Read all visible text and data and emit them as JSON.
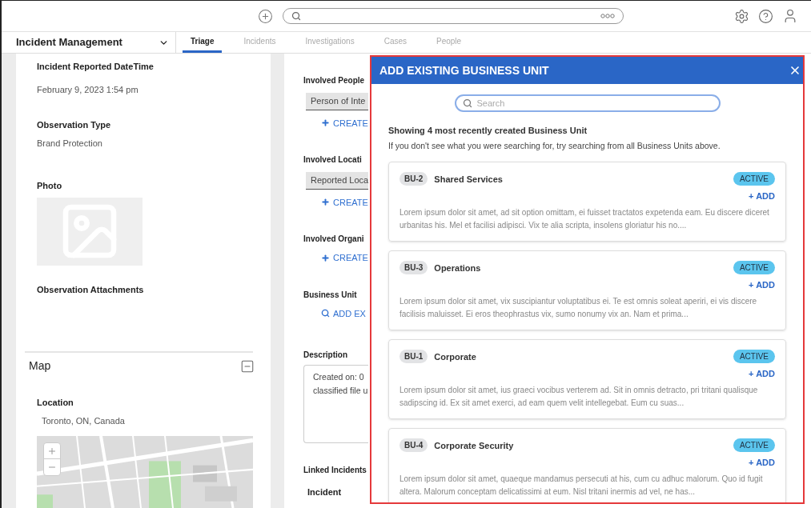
{
  "nav": {
    "module": "Incident Management",
    "tabs": [
      {
        "label": "Triage",
        "selected": true
      },
      {
        "label": "Incidents",
        "selected": false
      },
      {
        "label": "Investigations",
        "selected": false
      },
      {
        "label": "Cases",
        "selected": false
      },
      {
        "label": "People",
        "selected": false
      }
    ]
  },
  "left_panel": {
    "fields": [
      {
        "label": "Incident Reported DateTime",
        "value": "February 9, 2023 1:54 pm"
      },
      {
        "label": "Observation Type",
        "value": "Brand Protection"
      }
    ],
    "photo_label": "Photo",
    "attachments_label": "Observation Attachments",
    "map": {
      "title": "Map",
      "location_label": "Location",
      "location_value": "Toronto, ON, Canada"
    }
  },
  "middle_panel": {
    "sections": [
      {
        "kind": "chip",
        "label": "Involved People",
        "chip": "Person of Inte",
        "action": "CREATE"
      },
      {
        "kind": "chip",
        "label": "Involved Locati",
        "chip": "Reported Loca",
        "action": "CREATE"
      },
      {
        "kind": "create",
        "label": "Involved Organi",
        "action": "CREATE"
      },
      {
        "kind": "search",
        "label": "Business Unit",
        "action": "ADD EX"
      },
      {
        "kind": "textarea",
        "label": "Description",
        "lines": [
          "Created on: 0",
          "classified file u"
        ]
      },
      {
        "kind": "table",
        "label": "Linked Incidents",
        "column": "Incident"
      }
    ]
  },
  "modal": {
    "title": "ADD EXISTING BUSINESS UNIT",
    "search": {
      "placeholder": "Search"
    },
    "heading": "Showing 4 most recently created Business Unit",
    "subtext": "If you don't see what you were searching for, try searching from all Business Units above.",
    "units": [
      {
        "code": "BU-2",
        "name": "Shared Services",
        "status": "ACTIVE",
        "action": "+ ADD",
        "description": "Lorem ipsum dolor sit amet, ad sit option omittam, ei fuisset tractatos expetenda eam. Eu discere diceret urbanitas his. Mel et facilisi adipisci. Vix te alia scripta, insolens gloriatur his no...."
      },
      {
        "code": "BU-3",
        "name": "Operations",
        "status": "ACTIVE",
        "action": "+ ADD",
        "description": "Lorem ipsum dolor sit amet, vix suscipiantur voluptatibus ei. Te est omnis soleat aperiri, ei vis discere facilisis maluisset. Ei eros theophrastus vix, sumo nonumy vix an. Nam et prima..."
      },
      {
        "code": "BU-1",
        "name": "Corporate",
        "status": "ACTIVE",
        "action": "+ ADD",
        "description": "Lorem ipsum dolor sit amet, ius graeci vocibus verterem ad. Sit in omnis detracto, pri tritani qualisque sadipscing id. Ex sit amet exerci, ad eam quem velit intellegebat. Eum cu suas..."
      },
      {
        "code": "BU-4",
        "name": "Corporate Security",
        "status": "ACTIVE",
        "action": "+ ADD",
        "description": "Lorem ipsum dolor sit amet, quaeque mandamus persecuti at his, cum cu adhuc malorum. Quo id fugit altera. Malorum conceptam delicatissimi at eum. Nisl tritani inermis ad vel, ne has..."
      }
    ]
  }
}
